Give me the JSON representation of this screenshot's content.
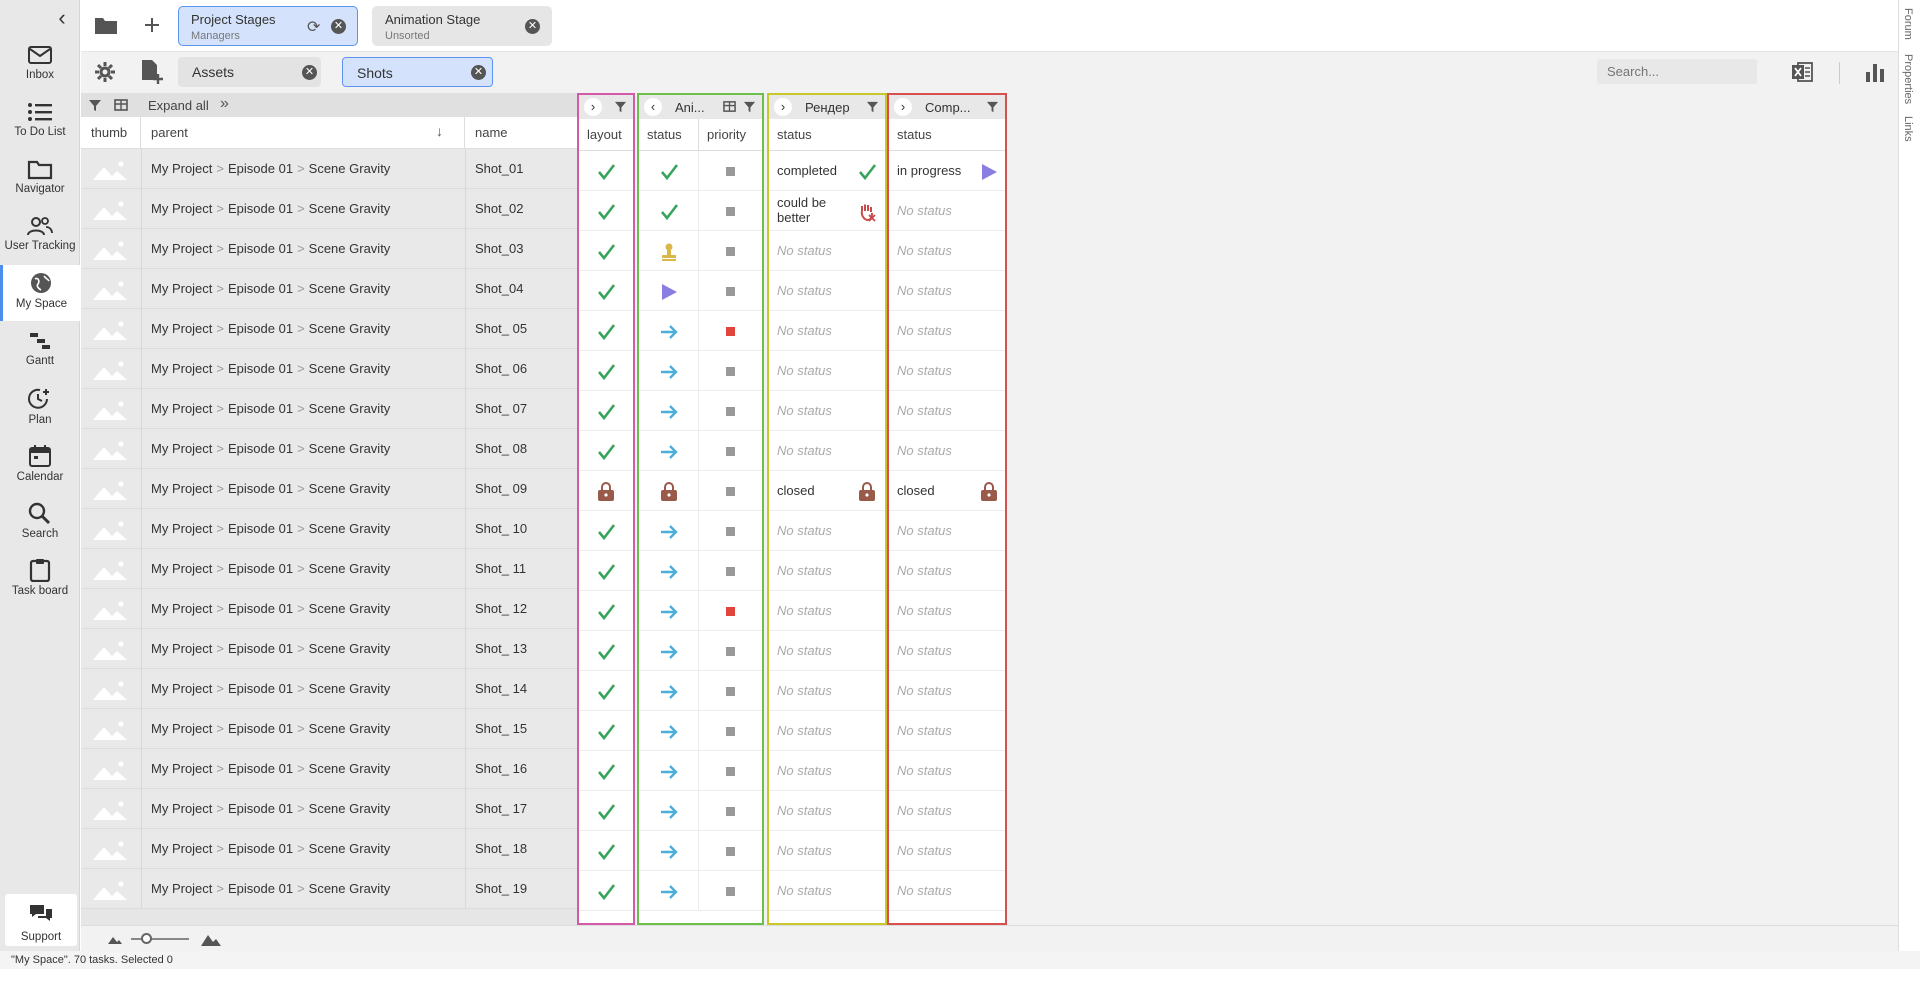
{
  "sidebar": {
    "collapse_icon": "chevron-left-icon",
    "items": [
      {
        "label": "Inbox",
        "icon": "mail-icon"
      },
      {
        "label": "To Do List",
        "icon": "list-icon"
      },
      {
        "label": "Navigator",
        "icon": "folder-icon"
      },
      {
        "label": "User Tracking",
        "icon": "users-icon"
      },
      {
        "label": "My Space",
        "icon": "globe-icon"
      },
      {
        "label": "Gantt",
        "icon": "gantt-icon"
      },
      {
        "label": "Plan",
        "icon": "clock-plus-icon"
      },
      {
        "label": "Calendar",
        "icon": "calendar-icon"
      },
      {
        "label": "Search",
        "icon": "search-icon"
      },
      {
        "label": "Task board",
        "icon": "clipboard-icon"
      }
    ],
    "support_label": "Support"
  },
  "right_links": [
    "Forum",
    "Properties",
    "Links"
  ],
  "stage_tabs": [
    {
      "title": "Project Stages",
      "subtitle": "Managers"
    },
    {
      "title": "Animation Stage",
      "subtitle": "Unsorted"
    }
  ],
  "entity_tabs": [
    "Assets",
    "Shots"
  ],
  "search": {
    "placeholder": "Search..."
  },
  "toolbar": {
    "expand_all": "Expand all"
  },
  "columns": {
    "thumb": "thumb",
    "parent": "parent",
    "name": "name"
  },
  "groups": {
    "layout": {
      "col": "layout"
    },
    "animation": {
      "title": "Ani...",
      "cols": [
        "status",
        "priority"
      ]
    },
    "render": {
      "title": "Рендер",
      "col": "status"
    },
    "comp": {
      "title": "Comp...",
      "col": "status"
    }
  },
  "parent_path": [
    "My Project",
    "Episode 01",
    "Scene Gravity"
  ],
  "rows": [
    {
      "name": "Shot_01",
      "layout": "check",
      "anim": "check",
      "priority": "gray",
      "render": "completed",
      "render_icon": "check",
      "comp": "in progress",
      "comp_icon": "play"
    },
    {
      "name": "Shot_02",
      "layout": "check",
      "anim": "check",
      "priority": "gray",
      "render": "could be better",
      "render_icon": "hand",
      "comp": "No status",
      "comp_icon": ""
    },
    {
      "name": "Shot_03",
      "layout": "check",
      "anim": "stamp",
      "priority": "gray",
      "render": "No status",
      "render_icon": "",
      "comp": "No status",
      "comp_icon": ""
    },
    {
      "name": "Shot_04",
      "layout": "check",
      "anim": "play",
      "priority": "gray",
      "render": "No status",
      "render_icon": "",
      "comp": "No status",
      "comp_icon": ""
    },
    {
      "name": "Shot_ 05",
      "layout": "check",
      "anim": "arrow",
      "priority": "red",
      "render": "No status",
      "render_icon": "",
      "comp": "No status",
      "comp_icon": ""
    },
    {
      "name": "Shot_ 06",
      "layout": "check",
      "anim": "arrow",
      "priority": "gray",
      "render": "No status",
      "render_icon": "",
      "comp": "No status",
      "comp_icon": ""
    },
    {
      "name": "Shot_ 07",
      "layout": "check",
      "anim": "arrow",
      "priority": "gray",
      "render": "No status",
      "render_icon": "",
      "comp": "No status",
      "comp_icon": ""
    },
    {
      "name": "Shot_ 08",
      "layout": "check",
      "anim": "arrow",
      "priority": "gray",
      "render": "No status",
      "render_icon": "",
      "comp": "No status",
      "comp_icon": ""
    },
    {
      "name": "Shot_ 09",
      "layout": "lock",
      "anim": "lock",
      "priority": "gray",
      "render": "closed",
      "render_icon": "lock",
      "comp": "closed",
      "comp_icon": "lock"
    },
    {
      "name": "Shot_ 10",
      "layout": "check",
      "anim": "arrow",
      "priority": "gray",
      "render": "No status",
      "render_icon": "",
      "comp": "No status",
      "comp_icon": ""
    },
    {
      "name": "Shot_ 11",
      "layout": "check",
      "anim": "arrow",
      "priority": "gray",
      "render": "No status",
      "render_icon": "",
      "comp": "No status",
      "comp_icon": ""
    },
    {
      "name": "Shot_ 12",
      "layout": "check",
      "anim": "arrow",
      "priority": "red",
      "render": "No status",
      "render_icon": "",
      "comp": "No status",
      "comp_icon": ""
    },
    {
      "name": "Shot_ 13",
      "layout": "check",
      "anim": "arrow",
      "priority": "gray",
      "render": "No status",
      "render_icon": "",
      "comp": "No status",
      "comp_icon": ""
    },
    {
      "name": "Shot_ 14",
      "layout": "check",
      "anim": "arrow",
      "priority": "gray",
      "render": "No status",
      "render_icon": "",
      "comp": "No status",
      "comp_icon": ""
    },
    {
      "name": "Shot_ 15",
      "layout": "check",
      "anim": "arrow",
      "priority": "gray",
      "render": "No status",
      "render_icon": "",
      "comp": "No status",
      "comp_icon": ""
    },
    {
      "name": "Shot_ 16",
      "layout": "check",
      "anim": "arrow",
      "priority": "gray",
      "render": "No status",
      "render_icon": "",
      "comp": "No status",
      "comp_icon": ""
    },
    {
      "name": "Shot_ 17",
      "layout": "check",
      "anim": "arrow",
      "priority": "gray",
      "render": "No status",
      "render_icon": "",
      "comp": "No status",
      "comp_icon": ""
    },
    {
      "name": "Shot_ 18",
      "layout": "check",
      "anim": "arrow",
      "priority": "gray",
      "render": "No status",
      "render_icon": "",
      "comp": "No status",
      "comp_icon": ""
    },
    {
      "name": "Shot_ 19",
      "layout": "check",
      "anim": "arrow",
      "priority": "gray",
      "render": "No status",
      "render_icon": "",
      "comp": "No status",
      "comp_icon": ""
    }
  ],
  "status_bar": "\"My Space\". 70 tasks. Selected 0",
  "colors": {
    "accent": "#4a8ef0",
    "layout_border": "#d35aa8",
    "animation_border": "#6cc04a",
    "render_border": "#c8c82a",
    "comp_border": "#d65050",
    "check": "#3aa35c",
    "arrow": "#4aaed8",
    "play": "#8a7fe0",
    "lock": "#9a5a4a"
  }
}
